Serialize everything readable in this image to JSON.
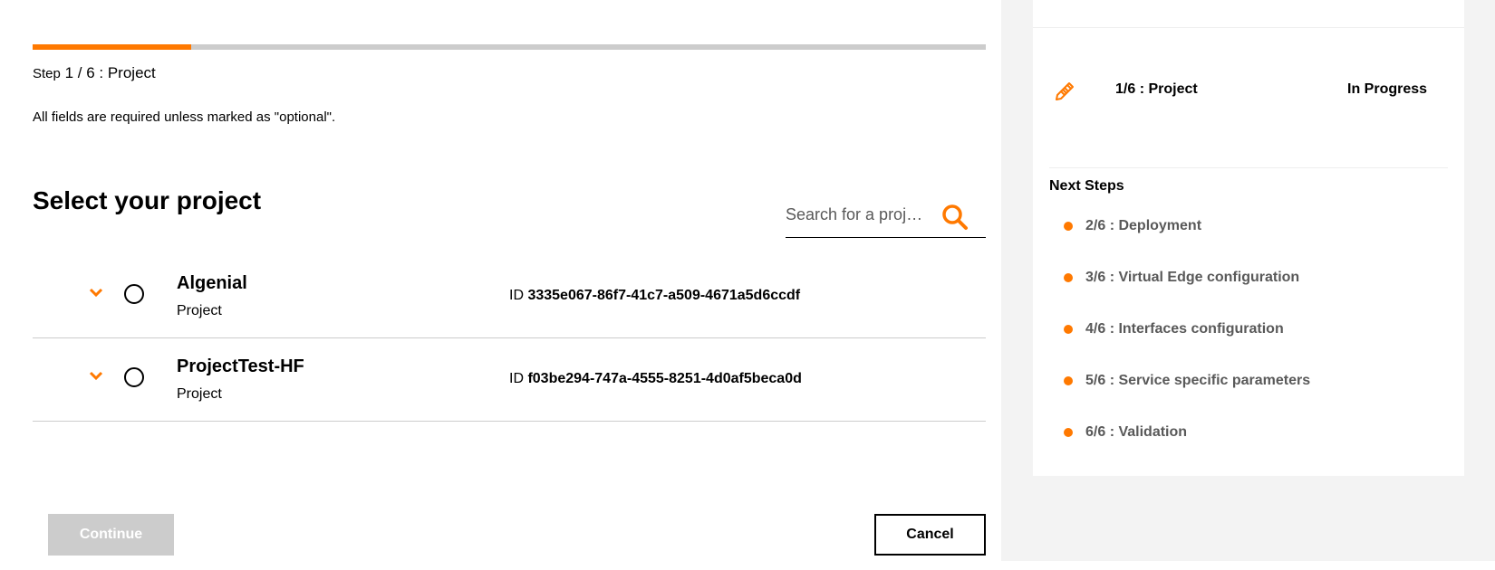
{
  "colors": {
    "accent": "#ff7900",
    "track": "#cccccc",
    "panel_bg": "#f3f3f3",
    "muted_text": "#595959"
  },
  "progress": {
    "fraction": 0.1667
  },
  "header": {
    "step_prefix": "Step",
    "step_text": "1 / 6 : Project",
    "required_note": "All fields are required unless marked as \"optional\"."
  },
  "section": {
    "title": "Select your project"
  },
  "search": {
    "placeholder": "Search for a proj…",
    "icon": "search-icon"
  },
  "projects": [
    {
      "name": "Algenial",
      "type": "Project",
      "id_label": "ID",
      "id": "3335e067-86f7-41c7-a509-4671a5d6ccdf"
    },
    {
      "name": "ProjectTest-HF",
      "type": "Project",
      "id_label": "ID",
      "id": "f03be294-747a-4555-8251-4d0af5beca0d"
    }
  ],
  "buttons": {
    "continue": "Continue",
    "cancel": "Cancel"
  },
  "side_panel": {
    "current": {
      "icon": "pencil-icon",
      "label": "1/6 : Project",
      "status": "In Progress"
    },
    "next_title": "Next Steps",
    "next_steps": [
      "2/6 : Deployment",
      "3/6 : Virtual Edge configuration",
      "4/6 : Interfaces configuration",
      "5/6 : Service specific parameters",
      "6/6 : Validation"
    ]
  }
}
